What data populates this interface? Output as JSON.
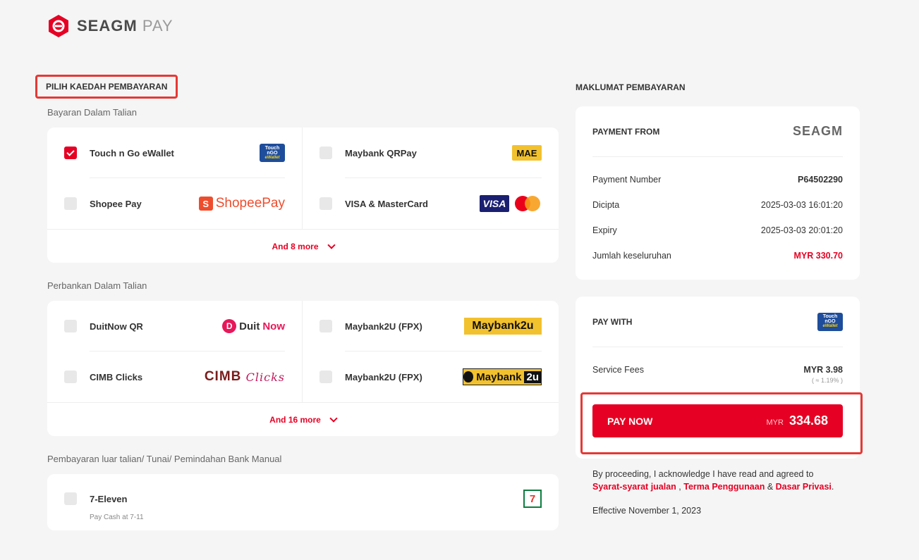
{
  "brand": {
    "name_main": "SEAGM",
    "name_suffix": "PAY"
  },
  "left": {
    "title": "PILIH KAEDAH PEMBAYARAN",
    "groups": [
      {
        "label": "Bayaran Dalam Talian",
        "methods": [
          {
            "name": "Touch n Go eWallet",
            "checked": true,
            "logo": "tng-ewallet-logo"
          },
          {
            "name": "Maybank QRPay",
            "checked": false,
            "logo": "mae-logo"
          },
          {
            "name": "Shopee Pay",
            "checked": false,
            "logo": "shopeepay-logo"
          },
          {
            "name": "VISA & MasterCard",
            "checked": false,
            "logo": "visa-mastercard-logo"
          }
        ],
        "more": "And 8 more"
      },
      {
        "label": "Perbankan Dalam Talian",
        "methods": [
          {
            "name": "DuitNow QR",
            "checked": false,
            "logo": "duitnow-logo"
          },
          {
            "name": "Maybank2U (FPX)",
            "checked": false,
            "logo": "maybank2u-logo"
          },
          {
            "name": "CIMB Clicks",
            "checked": false,
            "logo": "cimb-clicks-logo"
          },
          {
            "name": "Maybank2U (FPX)",
            "checked": false,
            "logo": "maybank2u-tiger-logo"
          }
        ],
        "more": "And 16 more"
      },
      {
        "label": "Pembayaran luar talian/ Tunai/ Pemindahan Bank Manual",
        "methods": [
          {
            "name": "7-Eleven",
            "sub": "Pay Cash at 7-11",
            "checked": false,
            "logo": "7eleven-logo"
          }
        ]
      }
    ],
    "logo_text": {
      "tng_top": "Touch",
      "tng_mid": "nGO",
      "tng_bottom": "eWallet",
      "mae": "MAE",
      "shopee_bag": "S",
      "shopee": "ShopeePay",
      "visa": "VISA",
      "duit_d": "D",
      "duit": "Duit",
      "now": "Now",
      "m2u": "Maybank2u",
      "cimb": "CIMB",
      "clicks": "Clicks",
      "m2u2_main": "Maybank",
      "m2u2_two": "2u",
      "seven": "7"
    }
  },
  "right": {
    "title": "MAKLUMAT PEMBAYARAN",
    "payment_from_label": "PAYMENT FROM",
    "payment_from_brand": "SEAGM",
    "rows": [
      {
        "k": "Payment Number",
        "v": "P64502290"
      },
      {
        "k": "Dicipta",
        "v": "2025-03-03 16:01:20"
      },
      {
        "k": "Expiry",
        "v": "2025-03-03 20:01:20"
      },
      {
        "k": "Jumlah keseluruhan",
        "v": "MYR 330.70"
      }
    ],
    "pay_with_label": "PAY WITH",
    "service_fees_label": "Service Fees",
    "service_fees_value": "MYR 3.98",
    "service_fees_note": "( ≈ 1.19% )",
    "pay_now_label": "PAY NOW",
    "pay_currency": "MYR",
    "pay_amount": "334.68",
    "terms_prefix": "By proceeding, I acknowledge I have read and agreed to",
    "terms_link1": "Syarat-syarat jualan",
    "terms_sep1": ",",
    "terms_link2": "Terma Penggunaan",
    "terms_sep2": "&",
    "terms_link3": "Dasar Privasi",
    "terms_end": ".",
    "effective": "Effective November 1, 2023"
  },
  "colors": {
    "accent": "#e60023",
    "highlight_border": "#e53935"
  }
}
